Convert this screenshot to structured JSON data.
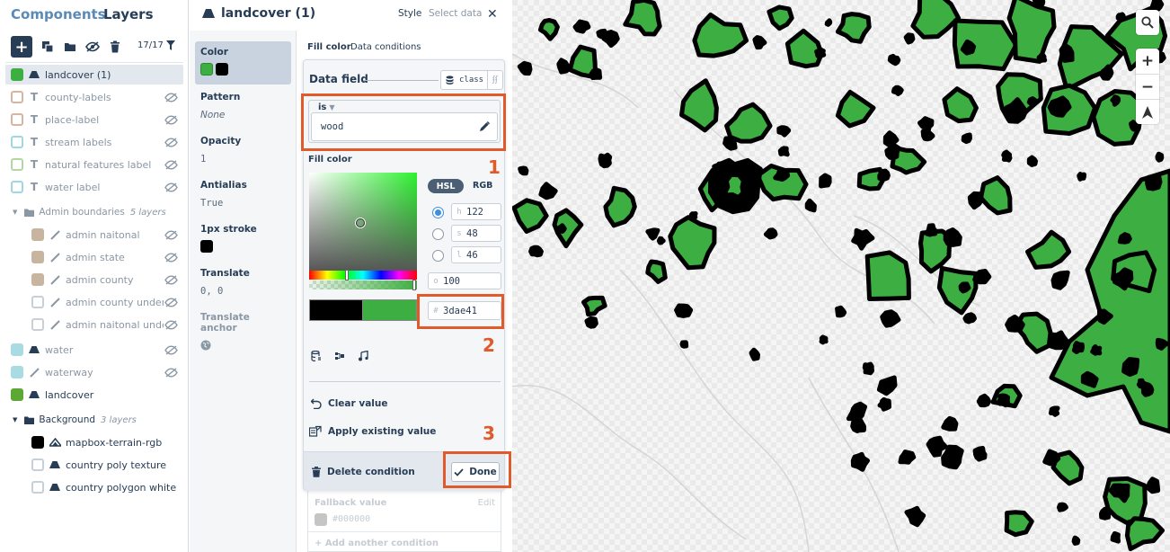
{
  "sidebar": {
    "tabs": {
      "components": "Components",
      "layers": "Layers"
    },
    "layer_count": "17/17",
    "layers": [
      {
        "label": "landcover (1)",
        "swatch": "#3dae41",
        "icon": "fill-icon",
        "active": true
      },
      {
        "label": "county-labels",
        "swatch": "#d9b49e",
        "icon": "text-icon"
      },
      {
        "label": "place-label",
        "swatch": "#d9b49e",
        "icon": "text-icon"
      },
      {
        "label": "stream labels",
        "swatch": "#9fd8e0",
        "icon": "text-icon"
      },
      {
        "label": "natural features label",
        "swatch": "#b5d6a3",
        "icon": "text-icon"
      },
      {
        "label": "water label",
        "swatch": "#9fd8e0",
        "icon": "text-icon"
      }
    ],
    "admin_group": {
      "label": "Admin boundaries",
      "count": "5 layers"
    },
    "admin_layers": [
      {
        "label": "admin naitonal",
        "swatch": "#c7b5a0"
      },
      {
        "label": "admin state",
        "swatch": "#c7b5a0"
      },
      {
        "label": "admin county",
        "swatch": "#c7b5a0"
      },
      {
        "label": "admin county under",
        "swatch": "#ffffff"
      },
      {
        "label": "admin naitonal under",
        "swatch": "#ffffff"
      }
    ],
    "more_layers": [
      {
        "label": "water",
        "swatch": "#a9dbe3",
        "icon": "fill-icon"
      },
      {
        "label": "waterway",
        "swatch": "#a9dbe3",
        "icon": "line-icon"
      },
      {
        "label": "landcover",
        "swatch": "#5da735",
        "icon": "fill-icon"
      }
    ],
    "background_group": {
      "label": "Background",
      "count": "3 layers"
    },
    "background_layers": [
      {
        "label": "mapbox-terrain-rgb",
        "swatch": "#000000"
      },
      {
        "label": "country poly texture",
        "swatch": "#ffffff"
      },
      {
        "label": "country polygon white",
        "swatch": "#ffffff"
      }
    ]
  },
  "panel": {
    "title": "landcover (1)",
    "tabs": {
      "style": "Style",
      "select_data": "Select data"
    },
    "props": {
      "color": "Color",
      "pattern": "Pattern",
      "pattern_value": "None",
      "opacity": "Opacity",
      "opacity_value": "1",
      "antialias": "Antialias",
      "antialias_value": "True",
      "stroke": "1px stroke",
      "translate": "Translate",
      "translate_value": "0, 0",
      "translate_anchor": "Translate anchor"
    },
    "editor_tabs": {
      "fill_color": "Fill color",
      "data_conditions": "Data conditions"
    },
    "data_field": {
      "label": "Data field",
      "field": "class"
    },
    "condition": {
      "operator": "is",
      "value": "wood"
    },
    "fill_color_label": "Fill color",
    "mode": {
      "hsl": "HSL",
      "rgb": "RGB"
    },
    "hsl": {
      "h": "122",
      "s": "48",
      "l": "46"
    },
    "hsl_prefixes": {
      "h": "h",
      "s": "s",
      "l": "l",
      "o": "o",
      "hex": "#"
    },
    "opacity": "100",
    "hex": "3dae41",
    "actions": {
      "clear": "Clear value",
      "apply": "Apply existing value",
      "delete": "Delete condition",
      "done": "Done"
    },
    "fallback": {
      "label": "Fallback value",
      "edit": "Edit",
      "value": "#000000"
    },
    "add_condition": "Add another condition",
    "annotations": [
      "1",
      "2",
      "3"
    ]
  },
  "colors": {
    "accent": "#3dae41",
    "navy": "#273d56",
    "highlight": "#e05a2b",
    "previous_color": "#000000"
  }
}
